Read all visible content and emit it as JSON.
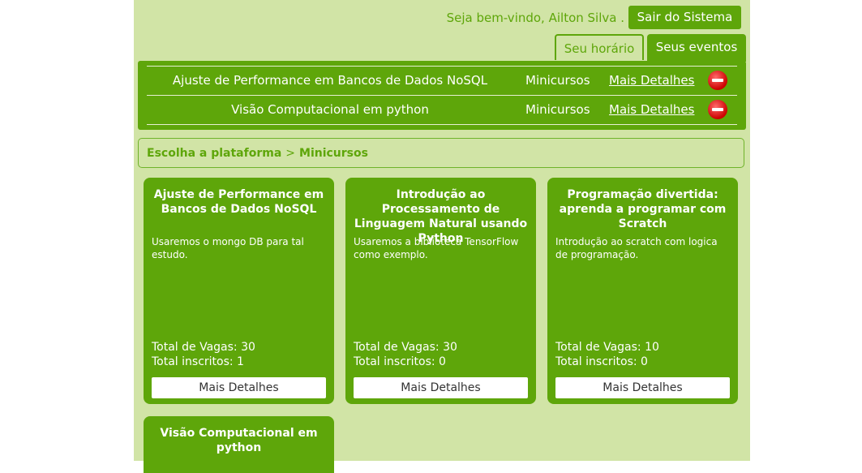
{
  "header": {
    "welcome_text": "Seja bem-vindo, Ailton Silva .",
    "logout_label": "Sair do Sistema"
  },
  "tabs": [
    {
      "label": "Seu horário",
      "active": false
    },
    {
      "label": "Seus eventos",
      "active": true
    }
  ],
  "events": [
    {
      "name": "Ajuste de Performance em Bancos de Dados NoSQL",
      "type": "Minicursos",
      "link_label": "Mais Detalhes",
      "action_icon": "remove-icon"
    },
    {
      "name": "Visão Computacional em python",
      "type": "Minicursos",
      "link_label": "Mais Detalhes",
      "action_icon": "remove-icon"
    }
  ],
  "breadcrumb": {
    "root": "Escolha a plataforma",
    "separator": ">",
    "current": "Minicursos"
  },
  "cards": [
    {
      "title": "Ajuste de Performance em Bancos de Dados NoSQL",
      "description": "Usaremos o mongo DB para tal estudo.",
      "vagas": "Total de Vagas: 30",
      "inscritos": "Total inscritos: 1",
      "button_label": "Mais Detalhes"
    },
    {
      "title": "Introdução ao Processamento de Linguagem Natural usando Python",
      "description": "Usaremos a biblioteca TensorFlow como exemplo.",
      "vagas": "Total de Vagas: 30",
      "inscritos": "Total inscritos: 0",
      "button_label": "Mais Detalhes"
    },
    {
      "title": "Programação divertida: aprenda a programar com Scratch",
      "description": "Introdução ao scratch com logica de programação.",
      "vagas": "Total de Vagas: 10",
      "inscritos": "Total inscritos: 0",
      "button_label": "Mais Detalhes"
    },
    {
      "title": "Visão Computacional em python"
    }
  ],
  "colors": {
    "background": "#d1e4a6",
    "accent": "#5ea60a",
    "remove": "#cc0000"
  }
}
